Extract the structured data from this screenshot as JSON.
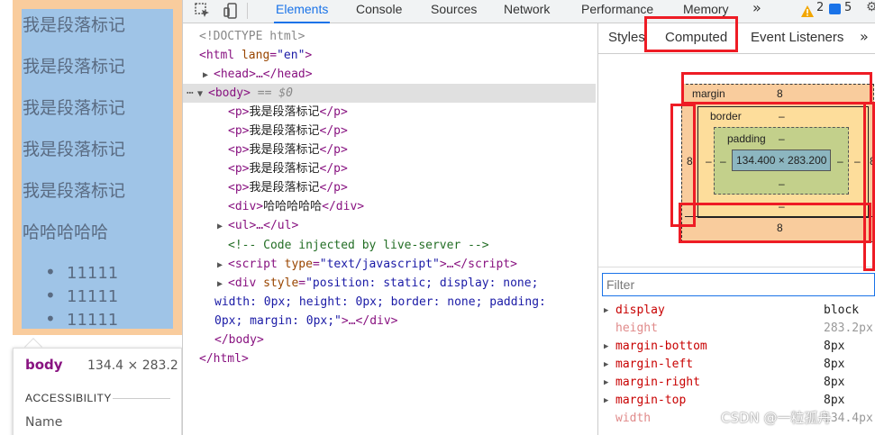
{
  "preview": {
    "paragraphs": [
      "我是段落标记",
      "我是段落标记",
      "我是段落标记",
      "我是段落标记",
      "我是段落标记"
    ],
    "div_text": "哈哈哈哈哈",
    "list_items": [
      "11111",
      "11111",
      "11111"
    ],
    "tooltip": {
      "element": "body",
      "size": "134.4 × 283.2",
      "section": "ACCESSIBILITY",
      "name_label": "Name"
    }
  },
  "toolbar": {
    "tabs": [
      "Elements",
      "Console",
      "Sources",
      "Network",
      "Performance",
      "Memory"
    ],
    "active_tab": "Elements",
    "more": "»",
    "warnings": "2",
    "messages": "5",
    "settings": "⚙"
  },
  "tree": {
    "doctype": "<!DOCTYPE html>",
    "html_open_tag": "<html",
    "html_attr_name": "lang",
    "html_attr_value": "\"en\"",
    "head": "<head>…</head>",
    "body_open": "<body>",
    "body_eq": "== $0",
    "p_lines": [
      "我是段落标记",
      "我是段落标记",
      "我是段落标记",
      "我是段落标记",
      "我是段落标记"
    ],
    "div_text": "哈哈哈哈哈",
    "ul": "<ul>…</ul>",
    "comment": "<!-- Code injected by live-server -->",
    "script_attr_value": "\"text/javascript\"",
    "div_style_line1": "\"position: static; display: none;",
    "div_style_line2": "width: 0px; height: 0px; border: none; padding:",
    "div_style_line3": "0px; margin: 0px;\"",
    "body_close": "</body>",
    "html_close": "</html>"
  },
  "sidepane": {
    "tabs": [
      "Styles",
      "Computed",
      "Event Listeners"
    ],
    "active_tab": "Computed",
    "more": "»",
    "box_model": {
      "margin_label": "margin",
      "margin_top": "8",
      "margin_left": "8",
      "margin_right": "8",
      "margin_bottom": "8",
      "border_label": "border",
      "border_top": "–",
      "border_bottom": "–",
      "border_left": "–",
      "border_right": "–",
      "padding_label": "padding",
      "padding_top": "–",
      "padding_bottom": "–",
      "padding_left": "–",
      "padding_right": "–",
      "content": "134.400 × 283.200"
    },
    "filter_placeholder": "Filter",
    "properties": [
      {
        "name": "display",
        "value": "block",
        "inherited": false
      },
      {
        "name": "height",
        "value": "283.2px",
        "inherited": true
      },
      {
        "name": "margin-bottom",
        "value": "8px",
        "inherited": false
      },
      {
        "name": "margin-left",
        "value": "8px",
        "inherited": false
      },
      {
        "name": "margin-right",
        "value": "8px",
        "inherited": false
      },
      {
        "name": "margin-top",
        "value": "8px",
        "inherited": false
      },
      {
        "name": "width",
        "value": "134.4px",
        "inherited": true
      }
    ]
  },
  "watermark": "CSDN @一粒孤舟",
  "colors": {
    "accent": "#1a73e8",
    "annotation": "#ee1c25",
    "margin_fill": "#f9cc9d",
    "content_fill": "#9fc4e7"
  }
}
